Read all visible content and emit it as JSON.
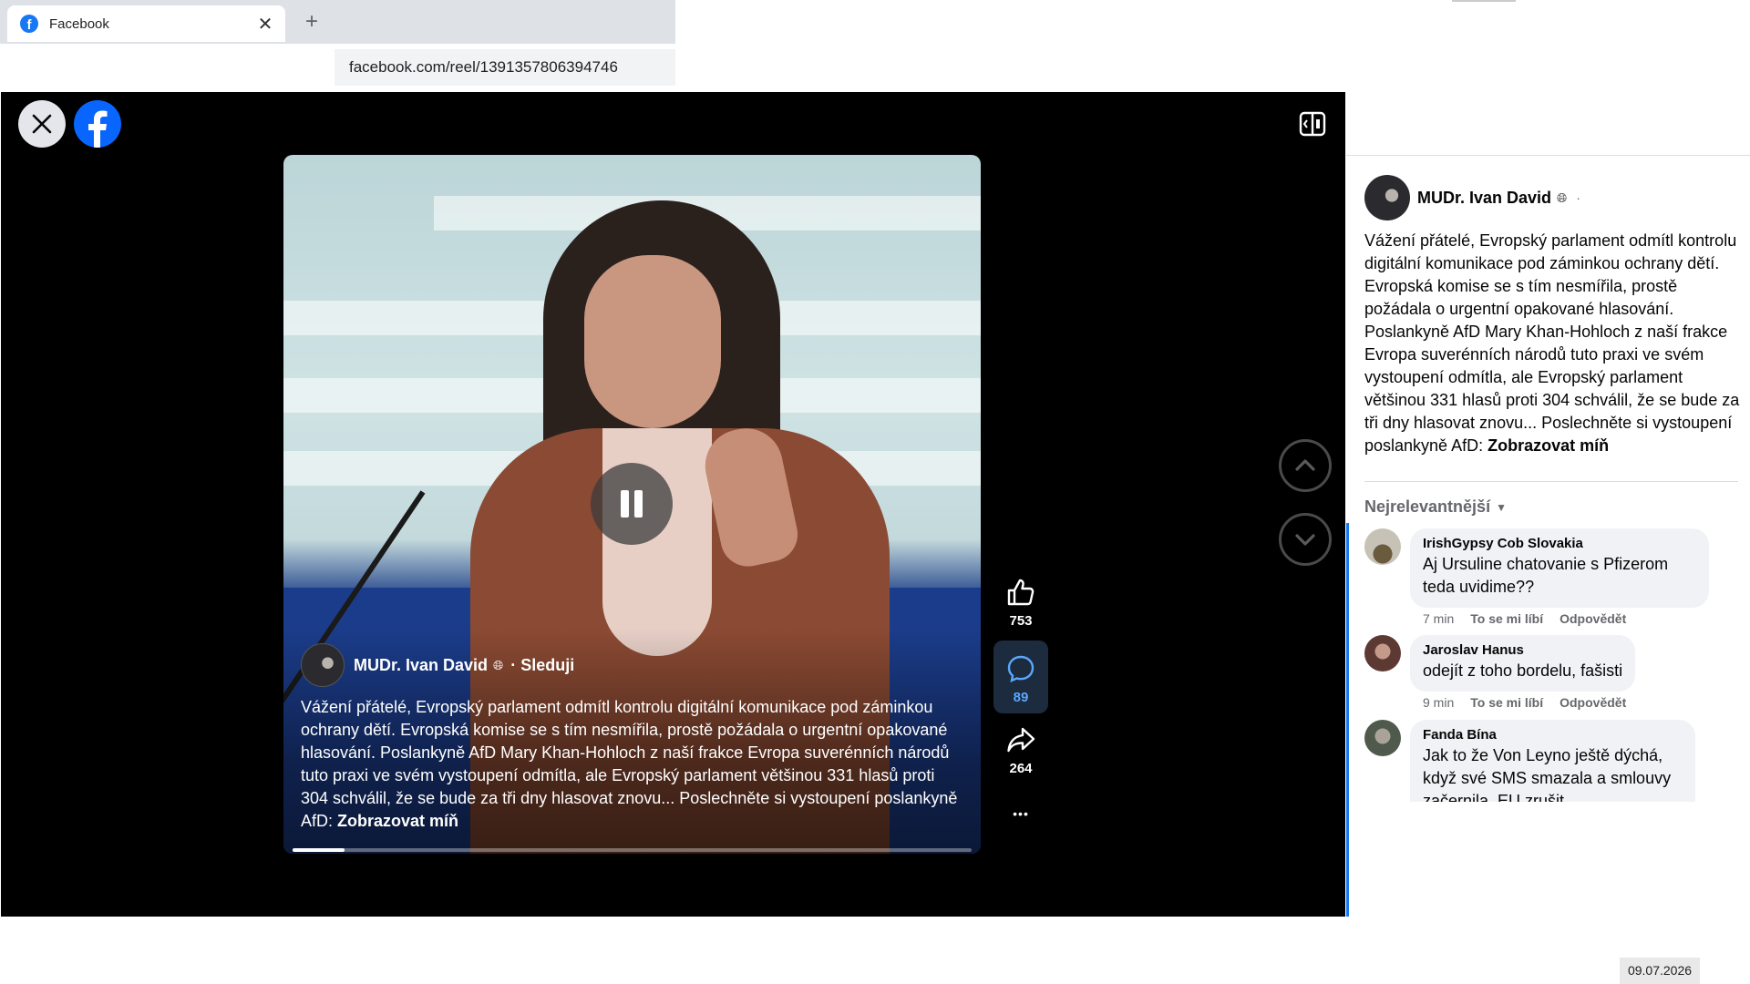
{
  "browser": {
    "tab_title": "Facebook",
    "tab_close": "✕",
    "new_tab": "+",
    "url": "facebook.com/reel/1391357806394746"
  },
  "reel": {
    "author": "MUDr. Ivan David",
    "follow_prefix": "·",
    "follow_label": "Sleduji",
    "caption": "Vážení přátelé,  Evropský parlament odmítl kontrolu digitální komunikace pod záminkou ochrany dětí. Evropská komise se s tím nesmířila, prostě požádala o urgentní opakované hlasování. Poslankyně AfD Mary Khan-Hohloch z naší frakce Evropa suverénních národů tuto praxi ve svém vystoupení odmítla, ale Evropský parlament většinou 331 hlasů proti 304 schválil, že se bude za tři dny hlasovat znovu... Poslechněte si vystoupení poslankyně AfD:",
    "show_less": "Zobrazovat míň",
    "progress_fraction": 0.077,
    "likes": "753",
    "comments": "89",
    "shares": "264",
    "more": "•••"
  },
  "panel": {
    "author": "MUDr. Ivan David",
    "dot": "·",
    "text": "Vážení přátelé,  Evropský parlament odmítl kontrolu digitální komunikace pod záminkou ochrany dětí. Evropská komise se s tím nesmířila, prostě požádala o urgentní opakované hlasování. Poslankyně AfD Mary Khan-Hohloch z naší frakce Evropa suverénních národů tuto praxi ve svém vystoupení odmítla, ale Evropský parlament většinou 331 hlasů proti 304 schválil, že se bude za tři dny hlasovat znovu... Poslechněte si vystoupení poslankyně AfD:",
    "show_less": "Zobrazovat míň",
    "sort_label": "Nejrelevantnější",
    "comments": [
      {
        "name": "IrishGypsy Cob Slovakia",
        "text": "Aj Ursuline chatovanie s Pfizerom teda uvidime??",
        "time": "7 min",
        "like": "To se mi líbí",
        "reply": "Odpovědět"
      },
      {
        "name": "Jaroslav Hanus",
        "text": "odejít z toho bordelu, fašisti",
        "time": "9 min",
        "like": "To se mi líbí",
        "reply": "Odpovědět"
      },
      {
        "name": "Fanda Bína",
        "text": "Jak to že Von Leyno ještě dýchá, když své SMS smazala a smlouvy začernila. EU zrušit",
        "time": "",
        "like": "",
        "reply": ""
      }
    ]
  },
  "taskbar": {
    "date": "09.07.2026"
  },
  "colors": {
    "accent": "#1877f2",
    "viewer_bg": "#000000",
    "bubble": "#f0f2f5"
  }
}
